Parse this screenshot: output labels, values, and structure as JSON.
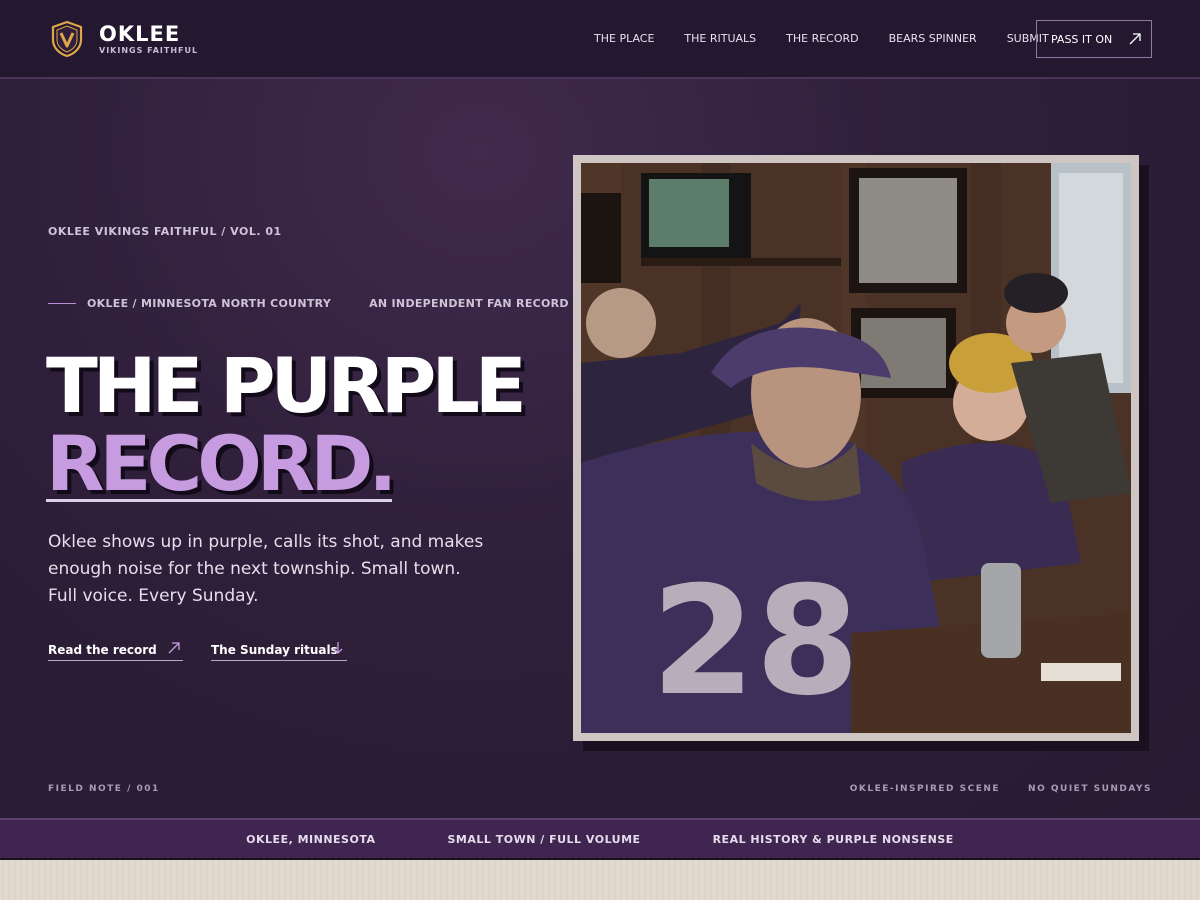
{
  "brand": {
    "name": "OKLEE",
    "subtitle": "VIKINGS FAITHFUL",
    "logo_icon": "shield-v-icon",
    "accent": "#e0a64a"
  },
  "nav": {
    "items": [
      {
        "label": "THE PLACE"
      },
      {
        "label": "THE RITUALS"
      },
      {
        "label": "THE RECORD"
      },
      {
        "label": "BEARS SPINNER"
      },
      {
        "label": "SUBMIT"
      }
    ],
    "cta_label": "PASS IT ON",
    "cta_icon": "arrow-up-right-icon"
  },
  "hero": {
    "eyebrow": "OKLEE VIKINGS FAITHFUL / VOL. 01",
    "kicker_location": "OKLEE / MINNESOTA NORTH COUNTRY",
    "kicker_tag": "AN INDEPENDENT FAN RECORD",
    "title_line1": "THE PURPLE",
    "title_line2": "RECORD.",
    "lede": "Oklee shows up in purple, calls its shot, and makes enough noise for the next township. Small town. Full voice. Every Sunday.",
    "cta_primary": "Read the record",
    "cta_primary_icon": "arrow-up-right-icon",
    "cta_secondary": "The Sunday rituals",
    "cta_secondary_icon": "arrow-down-icon",
    "photo_alt": "Fans in purple jerseys watching a game in a wood-paneled bar",
    "jersey_number": "28"
  },
  "footer_notes": {
    "left": "FIELD NOTE / 001",
    "right_1": "OKLEE-INSPIRED SCENE",
    "right_2": "NO QUIET SUNDAYS"
  },
  "ticker": {
    "items": [
      "OKLEE, MINNESOTA",
      "SMALL TOWN / FULL VOLUME",
      "REAL HISTORY & PURPLE NONSENSE"
    ]
  },
  "colors": {
    "background": "#2a1b34",
    "purple_accent": "#c79be0",
    "ticker": "#3f2550"
  }
}
